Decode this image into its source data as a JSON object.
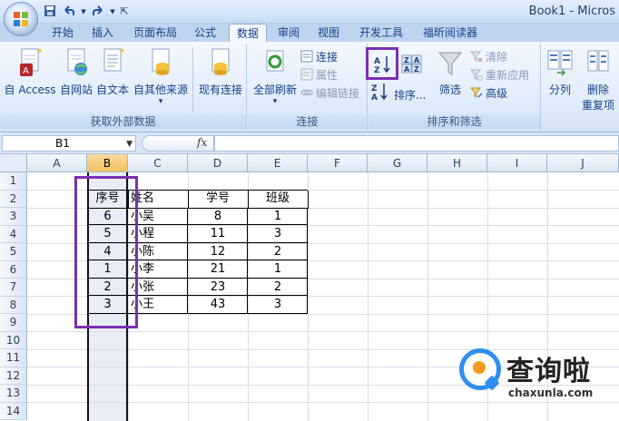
{
  "window": {
    "title": "Book1 - Micros"
  },
  "quick_access": {
    "save_icon": "save-icon",
    "undo_icon": "undo-icon",
    "redo_icon": "redo-icon",
    "customize_icon": "customize-icon"
  },
  "tabs": [
    {
      "label": "开始"
    },
    {
      "label": "插入"
    },
    {
      "label": "页面布局"
    },
    {
      "label": "公式"
    },
    {
      "label": "数据",
      "active": true
    },
    {
      "label": "审阅"
    },
    {
      "label": "视图"
    },
    {
      "label": "开发工具"
    },
    {
      "label": "福昕阅读器"
    }
  ],
  "ribbon": {
    "external": {
      "from_access": "自 Access",
      "from_web": "自网站",
      "from_text": "自文本",
      "from_other": "自其他来源",
      "existing": "现有连接",
      "group_label": "获取外部数据"
    },
    "connections": {
      "refresh_all": "全部刷新",
      "connections": "连接",
      "properties": "属性",
      "edit_links": "编辑链接",
      "group_label": "连接"
    },
    "sort_filter": {
      "sort": "排序...",
      "filter": "筛选",
      "clear": "清除",
      "reapply": "重新应用",
      "advanced": "高级",
      "group_label": "排序和筛选"
    },
    "tools": {
      "split": "分列",
      "remove_dup_1": "删除",
      "remove_dup_2": "重复项"
    }
  },
  "formula_bar": {
    "name_box": "B1",
    "fx": "fx",
    "value": ""
  },
  "columns": [
    "A",
    "B",
    "C",
    "D",
    "E",
    "F",
    "G",
    "H",
    "I",
    "J"
  ],
  "rows": [
    "1",
    "2",
    "3",
    "4",
    "5",
    "6",
    "7",
    "8",
    "9",
    "10",
    "11",
    "12",
    "13",
    "14"
  ],
  "table": {
    "headers": [
      "序号",
      "姓名",
      "学号",
      "班级"
    ],
    "rows": [
      [
        "6",
        "小吴",
        "8",
        "1"
      ],
      [
        "5",
        "小程",
        "11",
        "3"
      ],
      [
        "4",
        "小陈",
        "12",
        "2"
      ],
      [
        "1",
        "小李",
        "21",
        "1"
      ],
      [
        "2",
        "小张",
        "23",
        "2"
      ],
      [
        "3",
        "小王",
        "43",
        "3"
      ]
    ]
  },
  "watermark": {
    "cn": "查询啦",
    "en": "chaxunla.com"
  },
  "colors": {
    "highlight": "#7a2fb3",
    "ribbon": "#dbe6f5",
    "selected_column_fill": "#e8ecf6"
  }
}
